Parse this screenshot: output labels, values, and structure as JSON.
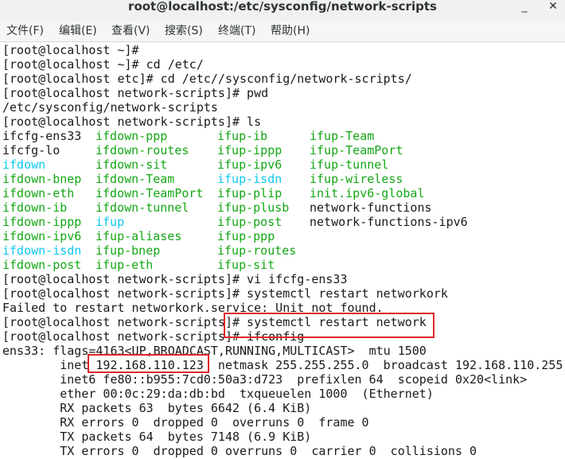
{
  "window": {
    "title": "root@localhost:/etc/sysconfig/network-scripts",
    "min_glyph": "_",
    "close_glyph": "✕"
  },
  "menu": {
    "items": [
      "文件(F)",
      "编辑(E)",
      "查看(V)",
      "搜索(S)",
      "终端(T)",
      "帮助(H)"
    ]
  },
  "terminal": {
    "lines": [
      "[root@localhost ~]# ",
      "[root@localhost ~]# cd /etc/",
      "[root@localhost etc]# cd /etc//sysconfig/network-scripts/",
      "[root@localhost network-scripts]# pwd",
      "/etc/sysconfig/network-scripts",
      "[root@localhost network-scripts]# ls"
    ],
    "ls_grid": [
      [
        {
          "text": "ifcfg-ens33",
          "color": "#1a1a1a"
        },
        {
          "text": "ifdown-ppp",
          "color": "#14a714"
        },
        {
          "text": "ifup-ib",
          "color": "#14a714"
        },
        {
          "text": "ifup-Team",
          "color": "#14a714"
        }
      ],
      [
        {
          "text": "ifcfg-lo",
          "color": "#1a1a1a"
        },
        {
          "text": "ifdown-routes",
          "color": "#14a714"
        },
        {
          "text": "ifup-ippp",
          "color": "#14a714"
        },
        {
          "text": "ifup-TeamPort",
          "color": "#14a714"
        }
      ],
      [
        {
          "text": "ifdown",
          "color": "#10c8ee"
        },
        {
          "text": "ifdown-sit",
          "color": "#14a714"
        },
        {
          "text": "ifup-ipv6",
          "color": "#14a714"
        },
        {
          "text": "ifup-tunnel",
          "color": "#14a714"
        }
      ],
      [
        {
          "text": "ifdown-bnep",
          "color": "#14a714"
        },
        {
          "text": "ifdown-Team",
          "color": "#14a714"
        },
        {
          "text": "ifup-isdn",
          "color": "#10c8ee"
        },
        {
          "text": "ifup-wireless",
          "color": "#14a714"
        }
      ],
      [
        {
          "text": "ifdown-eth",
          "color": "#14a714"
        },
        {
          "text": "ifdown-TeamPort",
          "color": "#14a714"
        },
        {
          "text": "ifup-plip",
          "color": "#14a714"
        },
        {
          "text": "init.ipv6-global",
          "color": "#14a714"
        }
      ],
      [
        {
          "text": "ifdown-ib",
          "color": "#14a714"
        },
        {
          "text": "ifdown-tunnel",
          "color": "#14a714"
        },
        {
          "text": "ifup-plusb",
          "color": "#14a714"
        },
        {
          "text": "network-functions",
          "color": "#1a1a1a"
        }
      ],
      [
        {
          "text": "ifdown-ippp",
          "color": "#14a714"
        },
        {
          "text": "ifup",
          "color": "#10c8ee"
        },
        {
          "text": "ifup-post",
          "color": "#14a714"
        },
        {
          "text": "network-functions-ipv6",
          "color": "#1a1a1a"
        }
      ],
      [
        {
          "text": "ifdown-ipv6",
          "color": "#14a714"
        },
        {
          "text": "ifup-aliases",
          "color": "#14a714"
        },
        {
          "text": "ifup-ppp",
          "color": "#14a714"
        },
        {
          "text": "",
          "color": "#1a1a1a"
        }
      ],
      [
        {
          "text": "ifdown-isdn",
          "color": "#10c8ee"
        },
        {
          "text": "ifup-bnep",
          "color": "#14a714"
        },
        {
          "text": "ifup-routes",
          "color": "#14a714"
        },
        {
          "text": "",
          "color": "#1a1a1a"
        }
      ],
      [
        {
          "text": "ifdown-post",
          "color": "#14a714"
        },
        {
          "text": "ifup-eth",
          "color": "#14a714"
        },
        {
          "text": "ifup-sit",
          "color": "#14a714"
        },
        {
          "text": "",
          "color": "#1a1a1a"
        }
      ]
    ],
    "after_lines": [
      "[root@localhost network-scripts]# vi ifcfg-ens33",
      "[root@localhost network-scripts]# systemctl restart networkork",
      "Failed to restart networkork.service: Unit not found.",
      "[root@localhost network-scripts]# systemctl restart network",
      "[root@localhost network-scripts]# ifconfig",
      "ens33: flags=4163<UP,BROADCAST,RUNNING,MULTICAST>  mtu 1500",
      "        inet 192.168.110.123  netmask 255.255.255.0  broadcast 192.168.110.255",
      "        inet6 fe80::b955:7cd0:50a3:d723  prefixlen 64  scopeid 0x20<link>",
      "        ether 00:0c:29:da:db:bd  txqueuelen 1000  (Ethernet)",
      "        RX packets 63  bytes 6642 (6.4 KiB)",
      "        RX errors 0  dropped 0  overruns 0  frame 0",
      "        TX packets 64  bytes 7148 (6.9 KiB)",
      "        TX errors 0  dropped 0 overruns 0  carrier 0  collisions 0"
    ],
    "highlight_color": "#e0242a"
  }
}
